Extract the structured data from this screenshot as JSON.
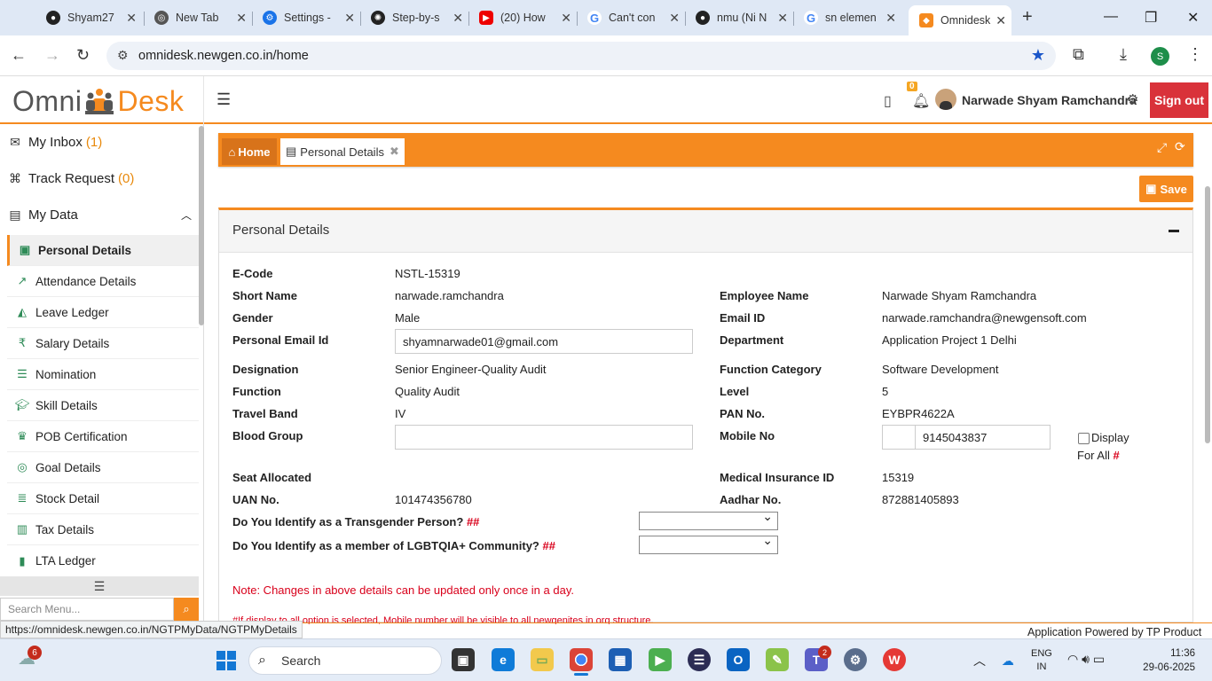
{
  "browser": {
    "tabs": [
      {
        "title": "Shyam27",
        "icon": "github-icon"
      },
      {
        "title": "New Tab",
        "icon": "chrome-icon"
      },
      {
        "title": "Settings -",
        "icon": "settings-icon"
      },
      {
        "title": "Step-by-s",
        "icon": "openai-icon"
      },
      {
        "title": "(20) How",
        "icon": "youtube-icon"
      },
      {
        "title": "Can't con",
        "icon": "google-icon"
      },
      {
        "title": "nmu (Ni N",
        "icon": "github-icon"
      },
      {
        "title": "sn elemen",
        "icon": "google-icon"
      },
      {
        "title": "Omnidesk",
        "icon": "omnidesk-icon"
      }
    ],
    "url": "omnidesk.newgen.co.in/home",
    "profile_initial": "S"
  },
  "header": {
    "logo_left": "Omni",
    "logo_right": "Desk",
    "notification_count": "0",
    "user_name": "Narwade Shyam Ramchandra",
    "sign_out": "Sign out"
  },
  "sidebar": {
    "top": [
      {
        "label": "My Inbox",
        "count": "(1)",
        "icon": "envelope-icon"
      },
      {
        "label": "Track Request",
        "count": "(0)",
        "icon": "sitemap-icon"
      },
      {
        "label": "My Data",
        "count": "",
        "icon": "id-card-icon"
      }
    ],
    "items": [
      {
        "label": "Personal Details",
        "icon": "user-card-icon"
      },
      {
        "label": "Attendance Details",
        "icon": "line-chart-icon"
      },
      {
        "label": "Leave Ledger",
        "icon": "area-chart-icon"
      },
      {
        "label": "Salary Details",
        "icon": "rupee-icon"
      },
      {
        "label": "Nomination",
        "icon": "list-icon"
      },
      {
        "label": "Skill Details",
        "icon": "graduation-cap-icon"
      },
      {
        "label": "POB Certification",
        "icon": "trophy-icon"
      },
      {
        "label": "Goal Details",
        "icon": "target-icon"
      },
      {
        "label": "Stock Detail",
        "icon": "stock-list-icon"
      },
      {
        "label": "Tax Details",
        "icon": "briefcase-icon"
      },
      {
        "label": "LTA Ledger",
        "icon": "bar-chart-icon"
      }
    ],
    "search_placeholder": "Search Menu..."
  },
  "tabs": {
    "home": "Home",
    "personal": "Personal Details"
  },
  "save_label": "Save",
  "panel": {
    "title": "Personal Details",
    "fields": {
      "ecode_label": "E-Code",
      "ecode": "NSTL-15319",
      "shortname_label": "Short Name",
      "shortname": "narwade.ramchandra",
      "empname_label": "Employee Name",
      "empname": "Narwade Shyam Ramchandra",
      "gender_label": "Gender",
      "gender": "Male",
      "email_label": "Email ID",
      "email": "narwade.ramchandra@newgensoft.com",
      "pemail_label": "Personal Email Id",
      "pemail": "shyamnarwade01@gmail.com",
      "dept_label": "Department",
      "dept": "Application Project 1 Delhi",
      "desig_label": "Designation",
      "desig": "Senior Engineer-Quality Audit",
      "funccat_label": "Function Category",
      "funccat": "Software Development",
      "func_label": "Function",
      "func": "Quality Audit",
      "level_label": "Level",
      "level": "5",
      "travel_label": "Travel Band",
      "travel": "IV",
      "pan_label": "PAN No.",
      "pan": "EYBPR4622A",
      "blood_label": "Blood Group",
      "blood": "",
      "mobile_label": "Mobile No",
      "mobile": "9145043837",
      "display_label1": "Display",
      "display_label2": "For All",
      "display_hash": "#",
      "seat_label": "Seat Allocated",
      "medical_label": "Medical Insurance ID",
      "medical": "15319",
      "uan_label": "UAN No.",
      "uan": "101474356780",
      "aadhar_label": "Aadhar No.",
      "aadhar": "872881405893",
      "trans_label": "Do You Identify as a Transgender Person?",
      "trans_hash": "##",
      "lgbt_label": "Do You Identify as a member of LGBTQIA+ Community?",
      "lgbt_hash": "##"
    },
    "note": "Note: Changes in above details can be updated only once in a day.",
    "note2": "#If display to all option is selected, Mobile number will be visible to all newgenites in org structure."
  },
  "status_url": "https://omnidesk.newgen.co.in/NGTPMyData/NGTPMyDetails",
  "powered": "Application Powered by TP Product",
  "taskbar": {
    "weather_badge": "6",
    "search": "Search",
    "teams_badge": "2",
    "lang1": "ENG",
    "lang2": "IN",
    "time": "11:36",
    "date": "29-06-2025"
  }
}
